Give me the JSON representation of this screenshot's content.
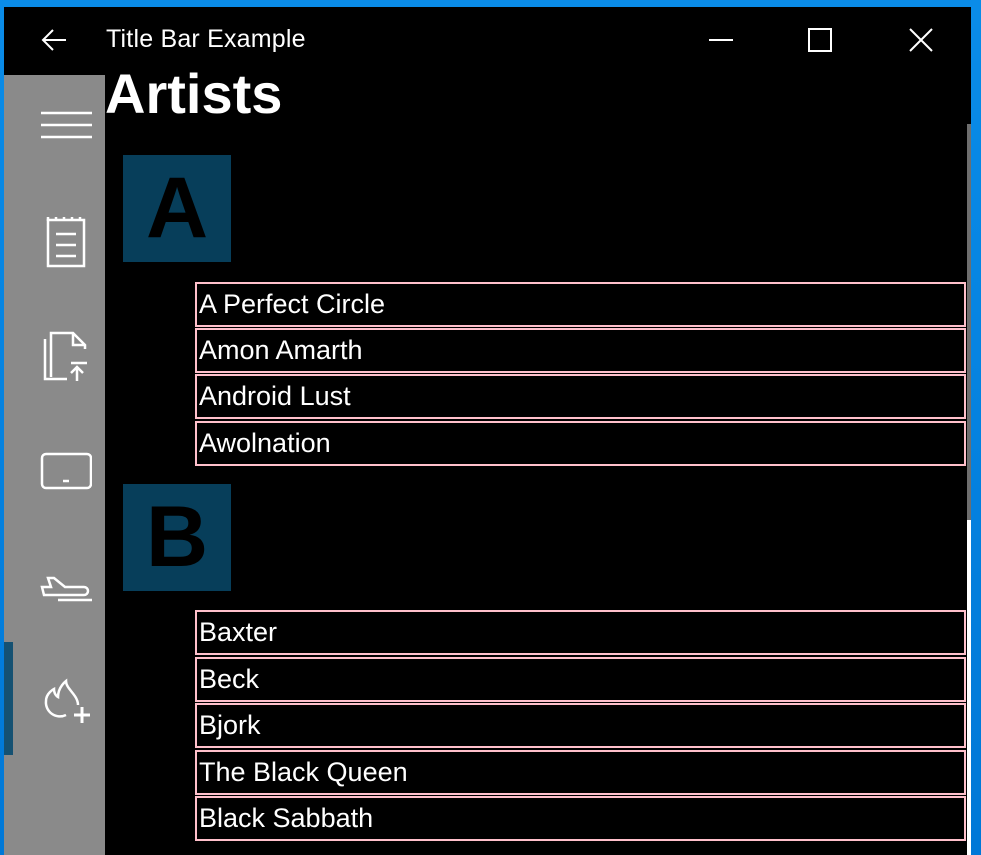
{
  "titlebar": {
    "title": "Title Bar Example",
    "back_icon": "arrow-left-icon",
    "minimize_icon": "minimize-icon",
    "maximize_icon": "maximize-icon",
    "close_icon": "close-icon"
  },
  "page": {
    "title": "Artists"
  },
  "sidebar": {
    "items": [
      {
        "icon": "hamburger-menu-icon"
      },
      {
        "icon": "notepad-icon"
      },
      {
        "icon": "document-upload-icon"
      },
      {
        "icon": "tablet-icon"
      },
      {
        "icon": "airplane-landing-icon"
      },
      {
        "icon": "flame-add-icon",
        "selected": true
      }
    ]
  },
  "groups": [
    {
      "letter": "A",
      "items": [
        "A Perfect Circle",
        "Amon Amarth",
        "Android Lust",
        "Awolnation"
      ]
    },
    {
      "letter": "B",
      "items": [
        "Baxter",
        "Beck",
        "Bjork",
        "The Black Queen",
        "Black Sabbath"
      ]
    }
  ],
  "colors": {
    "frame": "#0078d7",
    "tile": "#073e5a",
    "row_border": "#ffc0cb",
    "sidebar": "#8a8a8a",
    "selected": "#155172"
  }
}
